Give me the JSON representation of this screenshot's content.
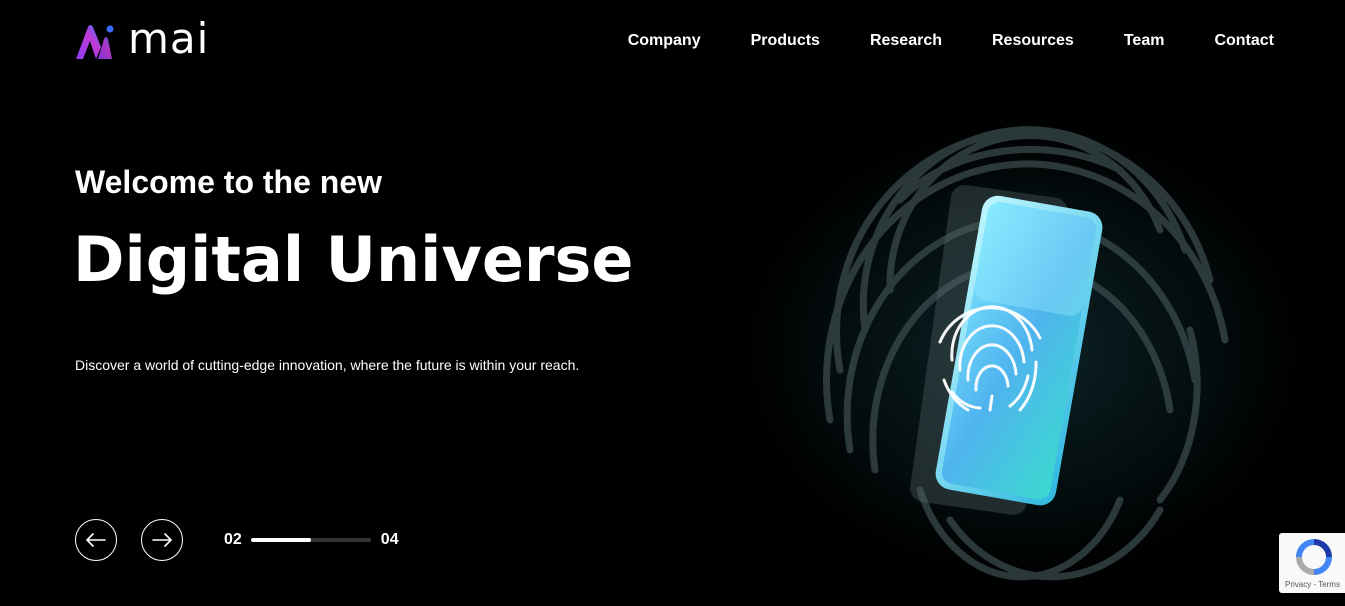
{
  "brand": {
    "name": "mai",
    "colors": {
      "gradient_start": "#8a3cf0",
      "gradient_mid": "#c23ad8",
      "gradient_end": "#2a7cff"
    }
  },
  "nav": {
    "items": [
      {
        "label": "Company"
      },
      {
        "label": "Products"
      },
      {
        "label": "Research"
      },
      {
        "label": "Resources"
      },
      {
        "label": "Team"
      },
      {
        "label": "Contact"
      }
    ]
  },
  "hero": {
    "eyebrow": "Welcome to the new",
    "title": "Digital Universe",
    "description": "Discover a world of cutting-edge innovation, where the future is within your reach.",
    "art_icon": "fingerprint-phone-icon"
  },
  "slider": {
    "prev_icon": "arrow-left-icon",
    "next_icon": "arrow-right-icon",
    "current": "02",
    "total": "04",
    "progress": 0.5
  },
  "recaptcha": {
    "links": "Privacy - Terms",
    "icon": "recaptcha-icon"
  }
}
